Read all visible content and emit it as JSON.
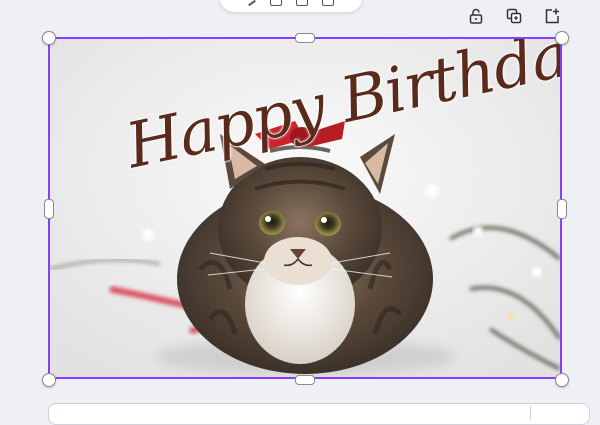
{
  "card": {
    "greeting": "Happy Birthday"
  },
  "top_actions": [
    {
      "name": "unlock",
      "icon": "unlock-icon"
    },
    {
      "name": "duplicate",
      "icon": "duplicate-icon"
    },
    {
      "name": "add-page",
      "icon": "add-page-icon"
    }
  ],
  "colors": {
    "selection": "#8b3dff",
    "greeting_text": "#5a2a1c",
    "background": "#eef0f6"
  }
}
